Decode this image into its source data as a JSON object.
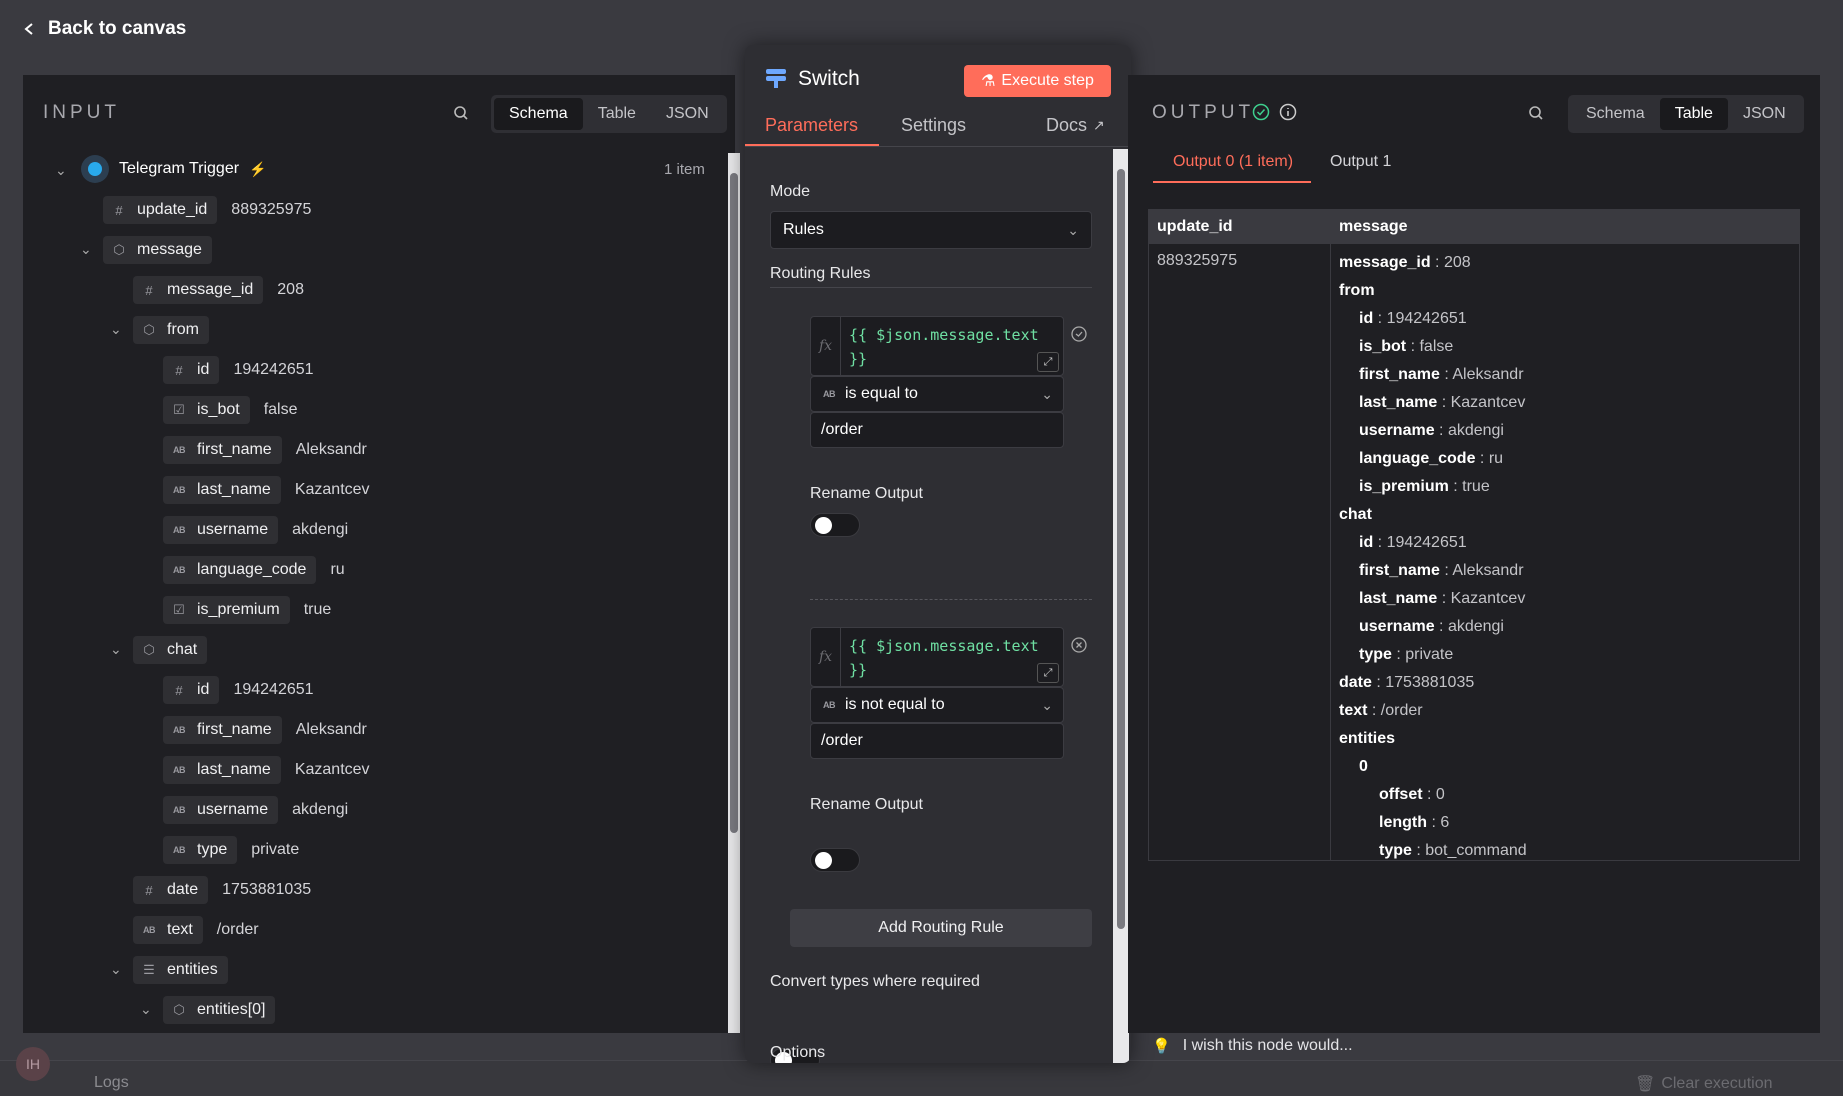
{
  "header": {
    "back_label": "Back to canvas"
  },
  "input": {
    "title": "INPUT",
    "tabs": [
      "Schema",
      "Table",
      "JSON"
    ],
    "active_tab": "Schema",
    "node_name": "Telegram Trigger",
    "item_count": "1 item",
    "tree": {
      "update_id": {
        "key": "update_id",
        "value": "889325975"
      },
      "message": {
        "key": "message"
      },
      "message_id": {
        "key": "message_id",
        "value": "208"
      },
      "from": {
        "key": "from"
      },
      "from_id": {
        "key": "id",
        "value": "194242651"
      },
      "from_is_bot": {
        "key": "is_bot",
        "value": "false"
      },
      "from_first_name": {
        "key": "first_name",
        "value": "Aleksandr"
      },
      "from_last_name": {
        "key": "last_name",
        "value": "Kazantcev"
      },
      "from_username": {
        "key": "username",
        "value": "akdengi"
      },
      "from_language_code": {
        "key": "language_code",
        "value": "ru"
      },
      "from_is_premium": {
        "key": "is_premium",
        "value": "true"
      },
      "chat": {
        "key": "chat"
      },
      "chat_id": {
        "key": "id",
        "value": "194242651"
      },
      "chat_first_name": {
        "key": "first_name",
        "value": "Aleksandr"
      },
      "chat_last_name": {
        "key": "last_name",
        "value": "Kazantcev"
      },
      "chat_username": {
        "key": "username",
        "value": "akdengi"
      },
      "chat_type": {
        "key": "type",
        "value": "private"
      },
      "date": {
        "key": "date",
        "value": "1753881035"
      },
      "text": {
        "key": "text",
        "value": "/order"
      },
      "entities": {
        "key": "entities"
      },
      "entities0": {
        "key": "entities[0]"
      }
    }
  },
  "params": {
    "node_title": "Switch",
    "execute_label": "Execute step",
    "tabs": {
      "parameters": "Parameters",
      "settings": "Settings",
      "docs": "Docs"
    },
    "mode_label": "Mode",
    "mode_value": "Rules",
    "routing_rules_label": "Routing Rules",
    "rule1": {
      "expr_line1": "{{ $json.message.text",
      "expr_line2": "}}",
      "operator": "is equal to",
      "value": "/order",
      "rename_label": "Rename Output"
    },
    "rule2": {
      "expr_line1": "{{ $json.message.text",
      "expr_line2": "}}",
      "operator": "is not equal to",
      "value": "/order",
      "rename_label": "Rename Output"
    },
    "add_rule_label": "Add Routing Rule",
    "convert_label": "Convert types where required",
    "options_label": "Options",
    "fx_label": "fx",
    "ab_label": "AB"
  },
  "output": {
    "title": "OUTPUT",
    "tabs": [
      "Schema",
      "Table",
      "JSON"
    ],
    "active_tab": "Table",
    "output_tabs": [
      "Output 0 (1 item)",
      "Output 1"
    ],
    "columns": [
      "update_id",
      "message"
    ],
    "update_id_value": "889325975",
    "message_lines": [
      {
        "key": "message_id",
        "value": "208"
      },
      {
        "key": "from"
      },
      {
        "key": "id",
        "value": "194242651"
      },
      {
        "key": "is_bot",
        "value": "false"
      },
      {
        "key": "first_name",
        "value": "Aleksandr"
      },
      {
        "key": "last_name",
        "value": "Kazantcev"
      },
      {
        "key": "username",
        "value": "akdengi"
      },
      {
        "key": "language_code",
        "value": "ru"
      },
      {
        "key": "is_premium",
        "value": "true"
      },
      {
        "key": "chat"
      },
      {
        "key": "id",
        "value": "194242651"
      },
      {
        "key": "first_name",
        "value": "Aleksandr"
      },
      {
        "key": "last_name",
        "value": "Kazantcev"
      },
      {
        "key": "username",
        "value": "akdengi"
      },
      {
        "key": "type",
        "value": "private"
      },
      {
        "key": "date",
        "value": "1753881035"
      },
      {
        "key": "text",
        "value": "/order"
      },
      {
        "key": "entities"
      },
      {
        "key": "0"
      },
      {
        "key": "offset",
        "value": "0"
      },
      {
        "key": "length",
        "value": "6"
      },
      {
        "key": "type",
        "value": "bot_command"
      }
    ]
  },
  "footer": {
    "feedback": "I wish this node would...",
    "logs": "Logs",
    "clear_execution": "Clear execution",
    "avatar_initials": "IH"
  },
  "colors": {
    "accent": "#ff6d5a",
    "bg": "#1f1f23",
    "success": "#3ecf8e",
    "code": "#6fe0a3"
  }
}
